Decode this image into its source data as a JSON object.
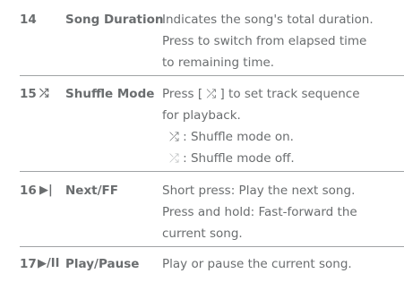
{
  "rows": [
    {
      "number": "14",
      "symbol": "",
      "name": "Song Duration",
      "lines": [
        "Indicates the song's total duration.",
        "Press to switch from elapsed time",
        "to remaining time."
      ]
    },
    {
      "number": "15",
      "symbol": "⤮",
      "name": "Shuffle Mode",
      "lines": [
        "Press [ ⤮ ] to set track sequence",
        "for playback."
      ],
      "sub_lines": [
        {
          "icon": "⤮",
          "text": " : Shuffle mode on."
        },
        {
          "icon": "⤮",
          "text": " : Shuffle mode off."
        }
      ]
    },
    {
      "number": "16",
      "symbol": "▶|",
      "name": "Next/FF",
      "lines": [
        "Short press: Play the next song.",
        "Press and hold: Fast-forward the",
        "current song."
      ]
    },
    {
      "number": "17",
      "symbol": "▶/II",
      "name": "Play/Pause",
      "lines": [
        "Play or pause the current song."
      ]
    }
  ]
}
